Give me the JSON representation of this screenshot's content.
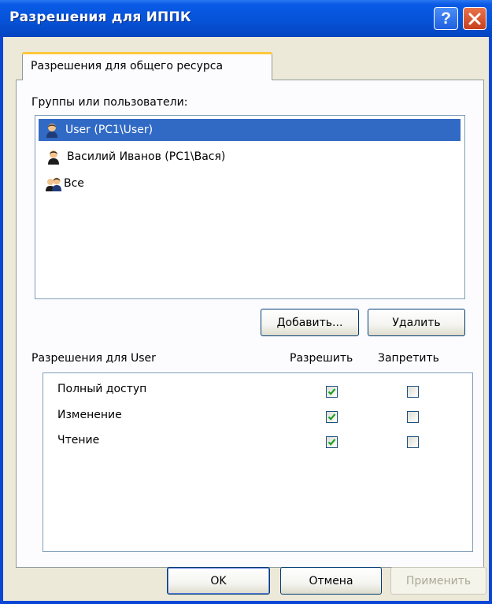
{
  "window": {
    "title": "Разрешения для ИППК"
  },
  "titlebar_buttons": {
    "help": "?"
  },
  "tabs": [
    {
      "label": "Разрешения для общего ресурса"
    }
  ],
  "groups": {
    "label": "Группы или пользователи:",
    "items": [
      {
        "name": "User (PC1\\User)",
        "icon": "user-icon",
        "selected": true
      },
      {
        "name": "Василий Иванов (PC1\\Вася)",
        "icon": "user-icon",
        "selected": false
      },
      {
        "name": "Все",
        "icon": "group-icon",
        "selected": false
      }
    ]
  },
  "buttons": {
    "add": "Добавить...",
    "remove": "Удалить",
    "ok": "OK",
    "cancel": "Отмена",
    "apply": "Применить"
  },
  "permissions": {
    "label": "Разрешения для User",
    "allow_header": "Разрешить",
    "deny_header": "Запретить",
    "rows": [
      {
        "name": "Полный доступ",
        "allow": true,
        "deny": false
      },
      {
        "name": "Изменение",
        "allow": true,
        "deny": false
      },
      {
        "name": "Чтение",
        "allow": true,
        "deny": false
      }
    ]
  },
  "colors": {
    "selection": "#316ac5",
    "titlebar": "#0653d8",
    "dialog": "#ece9d8",
    "check": "#21a121"
  }
}
